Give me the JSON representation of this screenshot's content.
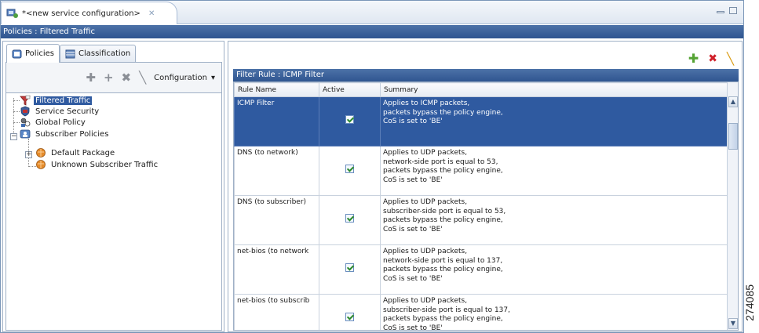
{
  "editor_tab": {
    "title": "*<new service configuration>",
    "close": "✕"
  },
  "header": {
    "breadcrumb": "Policies : Filtered Traffic"
  },
  "left_panel": {
    "tabs": [
      {
        "label": "Policies",
        "active": true
      },
      {
        "label": "Classification",
        "active": false
      }
    ],
    "toolbar": {
      "configuration_menu": "Configuration",
      "menu_arrow": "▾"
    },
    "tree": [
      {
        "label": "Filtered Traffic",
        "level": 1,
        "selected": true,
        "icon": "filter-icon"
      },
      {
        "label": "Service Security",
        "level": 1,
        "selected": false,
        "icon": "security-icon"
      },
      {
        "label": "Global Policy",
        "level": 1,
        "selected": false,
        "icon": "global-policy-icon"
      },
      {
        "label": "Subscriber Policies",
        "level": 1,
        "selected": false,
        "icon": "subscriber-policies-icon",
        "expanded": true
      },
      {
        "label": "Default Package",
        "level": 2,
        "selected": false,
        "icon": "package-icon",
        "expander": "+"
      },
      {
        "label": "Unknown Subscriber Traffic",
        "level": 2,
        "selected": false,
        "icon": "package-icon"
      }
    ]
  },
  "right_panel": {
    "rule_header": "Filter Rule : ICMP Filter",
    "columns": [
      "Rule Name",
      "Active",
      "Summary"
    ],
    "rows": [
      {
        "name": "ICMP Filter",
        "active": true,
        "selected": true,
        "summary": [
          "Applies to ICMP packets,",
          "packets bypass the policy engine,",
          "CoS is set to 'BE'"
        ]
      },
      {
        "name": "DNS (to network)",
        "active": true,
        "selected": false,
        "summary": [
          "Applies to UDP packets,",
          "network-side port is equal to 53,",
          "packets bypass the policy engine,",
          "CoS is set to 'BE'"
        ]
      },
      {
        "name": "DNS (to subscriber)",
        "active": true,
        "selected": false,
        "summary": [
          "Applies to UDP packets,",
          "subscriber-side port is equal to 53,",
          "packets bypass the policy engine,",
          "CoS is set to 'BE'"
        ]
      },
      {
        "name": "net-bios (to network",
        "active": true,
        "selected": false,
        "summary": [
          "Applies to UDP packets,",
          "network-side port is equal to 137,",
          "packets bypass the policy engine,",
          "CoS is set to 'BE'"
        ]
      },
      {
        "name": "net-bios (to subscrib",
        "active": true,
        "selected": false,
        "summary": [
          "Applies to UDP packets,",
          "subscriber-side port is equal to 137,",
          "packets bypass the policy engine,",
          "CoS is set to 'BE'"
        ]
      }
    ]
  },
  "figure_id": "274085"
}
